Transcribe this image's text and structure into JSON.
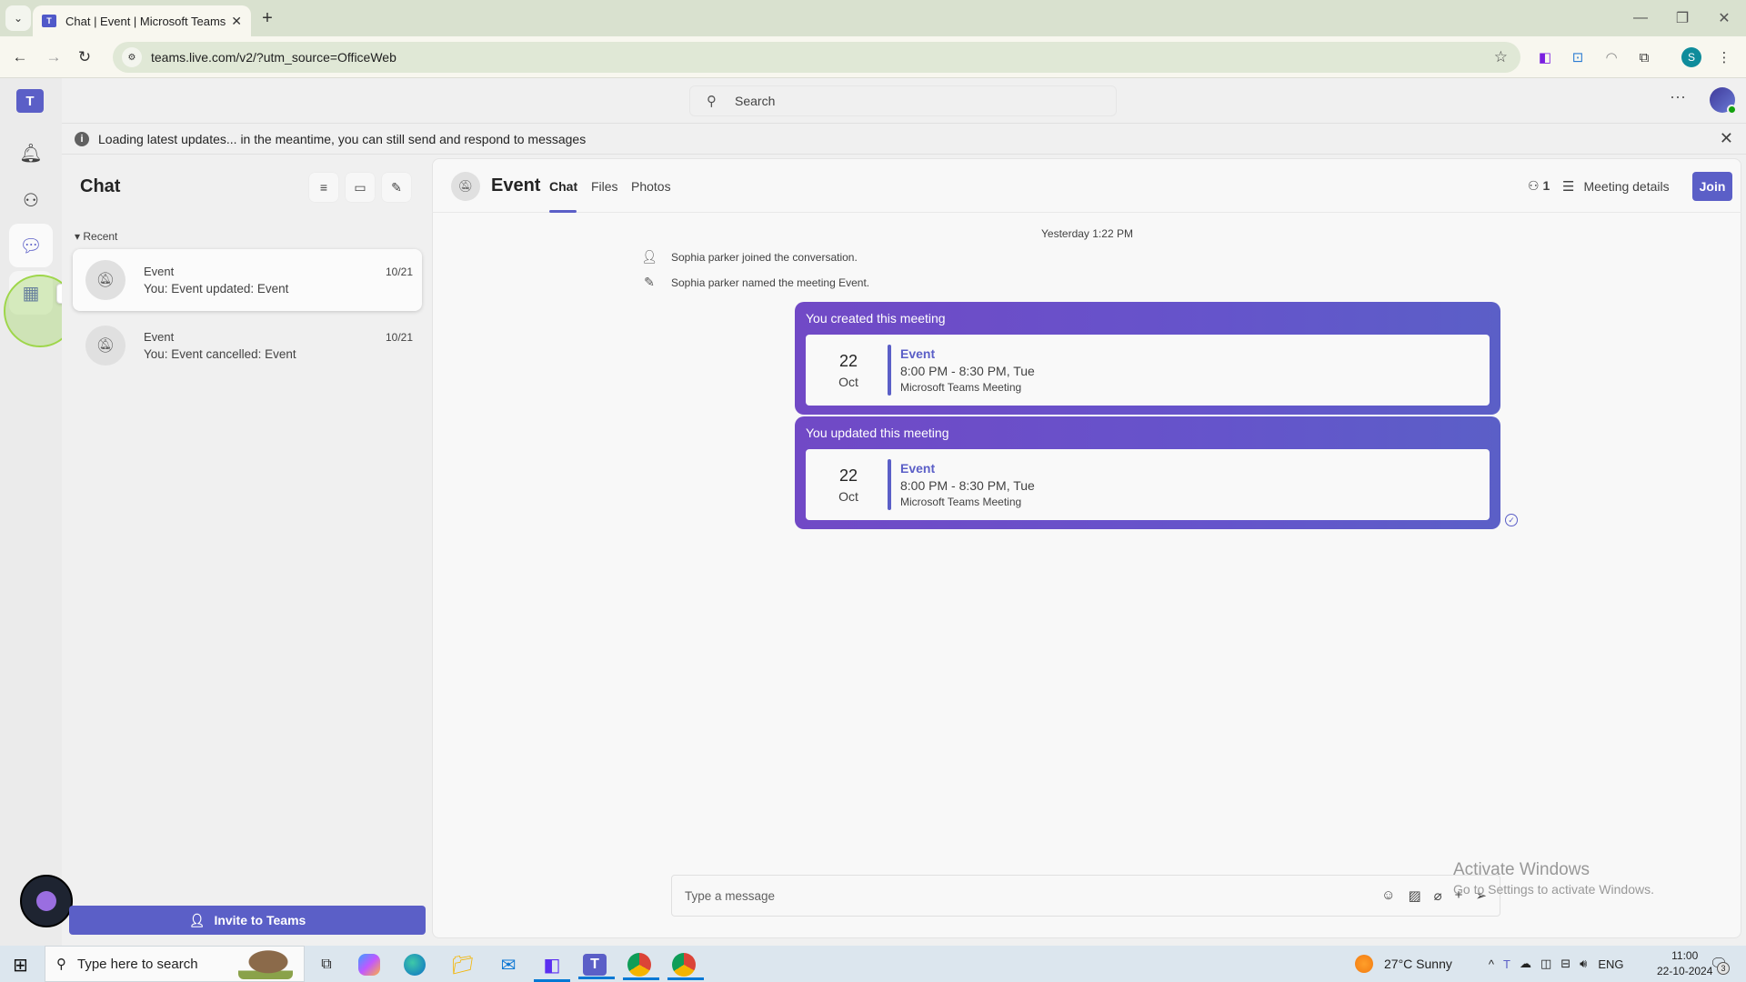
{
  "browser": {
    "tab_title": "Chat | Event | Microsoft Teams",
    "url": "teams.live.com/v2/?utm_source=OfficeWeb",
    "profile_initial": "S"
  },
  "teams": {
    "search_placeholder": "Search",
    "banner_text": "Loading latest updates... in the meantime, you can still send and respond to messages",
    "rail": {
      "tooltip": "Calendar"
    },
    "chat_list": {
      "title": "Chat",
      "section": "Recent",
      "items": [
        {
          "name": "Event",
          "preview": "You: Event updated: Event",
          "date": "10/21",
          "selected": true
        },
        {
          "name": "Event",
          "preview": "You: Event cancelled: Event",
          "date": "10/21",
          "selected": false
        }
      ],
      "invite_label": "Invite to Teams"
    },
    "conversation": {
      "title": "Event",
      "tabs": [
        {
          "label": "Chat",
          "active": true
        },
        {
          "label": "Files",
          "active": false
        },
        {
          "label": "Photos",
          "active": false
        }
      ],
      "participants_count": "1",
      "meeting_details_label": "Meeting details",
      "join_label": "Join",
      "timestamp": "Yesterday 1:22 PM",
      "system_messages": [
        {
          "icon": "person-add-icon",
          "text": "Sophia parker joined the conversation."
        },
        {
          "icon": "pencil-icon",
          "text": "Sophia parker named the meeting Event."
        }
      ],
      "meeting_cards": [
        {
          "header": "You created this meeting",
          "day": "22",
          "month": "Oct",
          "title": "Event",
          "time": "8:00 PM - 8:30 PM, Tue",
          "type": "Microsoft Teams Meeting"
        },
        {
          "header": "You updated this meeting",
          "day": "22",
          "month": "Oct",
          "title": "Event",
          "time": "8:00 PM - 8:30 PM, Tue",
          "type": "Microsoft Teams Meeting"
        }
      ],
      "compose_placeholder": "Type a message"
    }
  },
  "watermark": {
    "line1": "Activate Windows",
    "line2": "Go to Settings to activate Windows."
  },
  "taskbar": {
    "search_placeholder": "Type here to search",
    "weather": "27°C  Sunny",
    "language": "ENG",
    "time": "11:00",
    "date": "22-10-2024",
    "notification_count": "3"
  },
  "colors": {
    "brand": "#5b5fc7",
    "card_gradient_start": "#7149c6",
    "presence_available": "#13a10e"
  }
}
